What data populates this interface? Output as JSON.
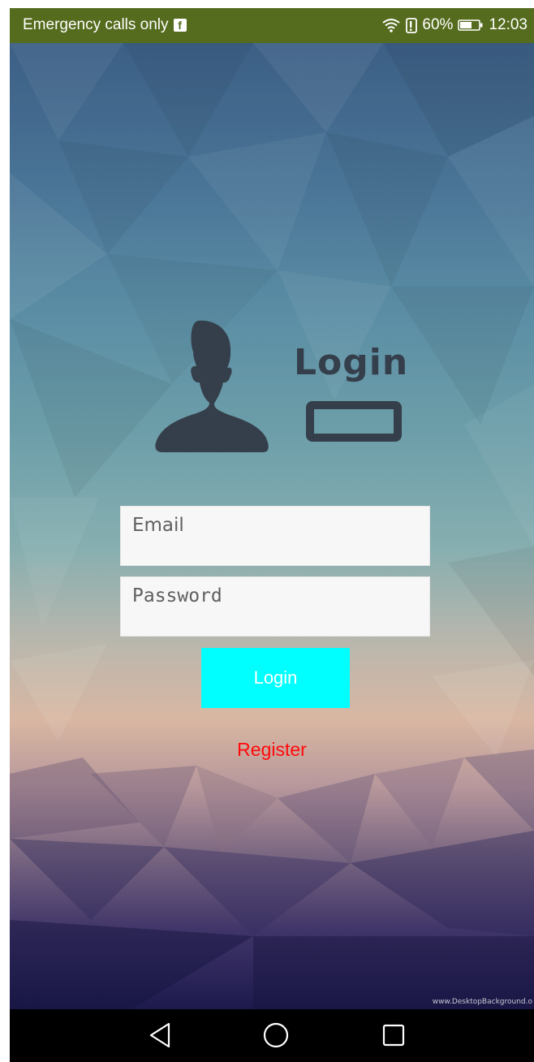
{
  "status_bar": {
    "carrier_text": "Emergency calls only",
    "notification_icon": "facebook-icon",
    "battery_percent": "60%",
    "time": "12:03",
    "background_color": "#556b1d"
  },
  "logo": {
    "title": "Login",
    "figure_icon": "user-silhouette-icon",
    "color": "#353f4b"
  },
  "form": {
    "email_placeholder": "Email",
    "password_placeholder": "Password",
    "login_label": "Login",
    "login_color": "#00ffff",
    "register_label": "Register",
    "register_color": "#ff0a0a"
  },
  "background": {
    "watermark": "www.DesktopBackground.o"
  },
  "nav_bar": {
    "back_icon": "back-triangle-icon",
    "home_icon": "home-circle-icon",
    "recents_icon": "recents-square-icon"
  }
}
